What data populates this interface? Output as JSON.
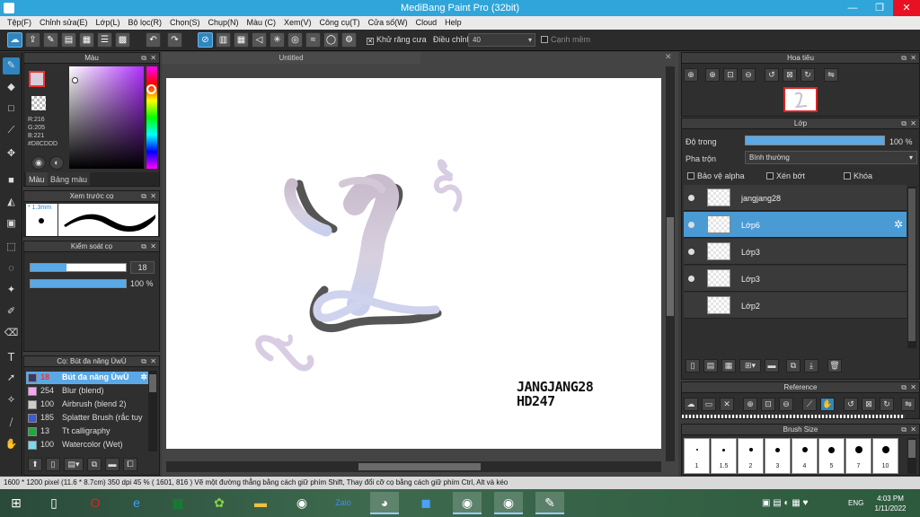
{
  "window": {
    "title": "MediBang Paint Pro (32bit)",
    "minimize": "—",
    "restore": "❐",
    "close": "✕"
  },
  "menu": [
    "Tệp(F)",
    "Chỉnh sửa(E)",
    "Lớp(L)",
    "Bộ lọc(R)",
    "Chọn(S)",
    "Chụp(N)",
    "Màu (C)",
    "Xem(V)",
    "Công cụ(T)",
    "Cửa số(W)",
    "Cloud",
    "Help"
  ],
  "toolbar": {
    "antialias_label": "Khử răng cưa",
    "adjust_label": "Điều chỉnh",
    "adjust_value": "40",
    "edge_label": "Cạnh mềm"
  },
  "color_panel": {
    "title": "Màu",
    "r": "R:216",
    "g": "G:205",
    "b": "B:221",
    "hex": "#D8CDDD",
    "tab_color": "Màu",
    "tab_palette": "Bảng màu",
    "main_color": "#D8CDDD"
  },
  "brush_preview": {
    "title": "Xem trước cọ",
    "size": "1.3mm"
  },
  "brush_control": {
    "title": "Kiểm soát cọ",
    "size_value": "18",
    "opacity_value": "100 %",
    "size_fraction": 0.38,
    "opacity_fraction": 1.0
  },
  "brush_list": {
    "title": "Cọ: Bút đa năng ÙwÙ",
    "items": [
      {
        "num": "18",
        "name": "Bút đa năng ÙwÙ",
        "swatch": "#3a3a6a",
        "active": true
      },
      {
        "num": "254",
        "name": "Blur (blend)",
        "swatch": "#f4a6f0"
      },
      {
        "num": "100",
        "name": "Airbrush (blend 2)",
        "swatch": "#cccccc"
      },
      {
        "num": "185",
        "name": "Splatter Brush (rắc tuy",
        "swatch": "#3b5bd6"
      },
      {
        "num": "13",
        "name": "Tt calligraphy",
        "swatch": "#1eaa3a"
      },
      {
        "num": "100",
        "name": "Watercolor (Wet)",
        "swatch": "#7ad8f0"
      }
    ]
  },
  "canvas": {
    "tab_title": "Untitled",
    "signature_line1": "JANGJANG28",
    "signature_line2": "HD247"
  },
  "navigator": {
    "title": "Hoa tiêu"
  },
  "layer_panel": {
    "title": "Lớp",
    "opacity_label": "Độ trong",
    "opacity_value": "100 %",
    "opacity_fraction": 1.0,
    "blend_label": "Pha trộn",
    "blend_value": "Bình thường",
    "protect_alpha": "Bảo vệ alpha",
    "clipping": "Xén bớt",
    "lock": "Khóa",
    "layers": [
      {
        "name": "jangjang28",
        "visible": true,
        "active": false
      },
      {
        "name": "Lớp6",
        "visible": true,
        "active": true
      },
      {
        "name": "Lớp3",
        "visible": true,
        "active": false
      },
      {
        "name": "Lớp3",
        "visible": true,
        "active": false
      },
      {
        "name": "Lớp2",
        "visible": false,
        "active": false
      }
    ]
  },
  "reference_panel": {
    "title": "Reference"
  },
  "brush_size_panel": {
    "title": "Brush Size",
    "sizes": [
      "1",
      "1.5",
      "2",
      "3",
      "4",
      "5",
      "7",
      "10"
    ]
  },
  "status_bar": {
    "text": "1600 * 1200 pixel   (11.6 * 8.7cm)   350 dpi   45 %   ( 1601, 816 )   Vẽ một đường thẳng bằng cách giữ phím Shift, Thay đổi cỡ cọ bằng cách giữ phím Ctrl, Alt và kéo"
  },
  "taskbar": {
    "lang": "ENG",
    "time": "4:03 PM",
    "date": "1/11/2022"
  }
}
